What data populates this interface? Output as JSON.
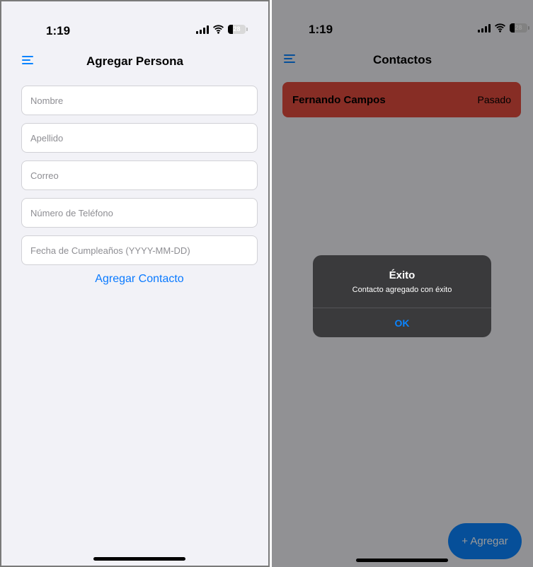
{
  "colors": {
    "accent": "#0a84ff",
    "contact_status_past": "#e14b3e",
    "background": "#f2f2f7",
    "alert_background": "#3a3a3c"
  },
  "left_screen": {
    "status_bar": {
      "time": "1:19",
      "battery_level": "28",
      "icons": [
        "signal-icon",
        "wifi-icon",
        "battery-icon"
      ]
    },
    "nav": {
      "menu_icon": "menu-icon",
      "title": "Agregar Persona"
    },
    "form": {
      "nombre": {
        "placeholder": "Nombre",
        "value": ""
      },
      "apellido": {
        "placeholder": "Apellido",
        "value": ""
      },
      "correo": {
        "placeholder": "Correo",
        "value": ""
      },
      "telefono": {
        "placeholder": "Número de Teléfono",
        "value": ""
      },
      "cumpleanos": {
        "placeholder": "Fecha de Cumpleaños (YYYY-MM-DD)",
        "value": ""
      },
      "submit_label": "Agregar Contacto"
    }
  },
  "right_screen": {
    "status_bar": {
      "time": "1:19",
      "battery_level": "28",
      "icons": [
        "signal-icon",
        "wifi-icon",
        "battery-icon"
      ]
    },
    "nav": {
      "menu_icon": "menu-icon",
      "title": "Contactos"
    },
    "contacts": [
      {
        "name": "Fernando Campos",
        "status": "Pasado"
      }
    ],
    "add_button_label": "+ Agregar",
    "alert": {
      "title": "Éxito",
      "message": "Contacto agregado con éxito",
      "ok_label": "OK"
    }
  }
}
